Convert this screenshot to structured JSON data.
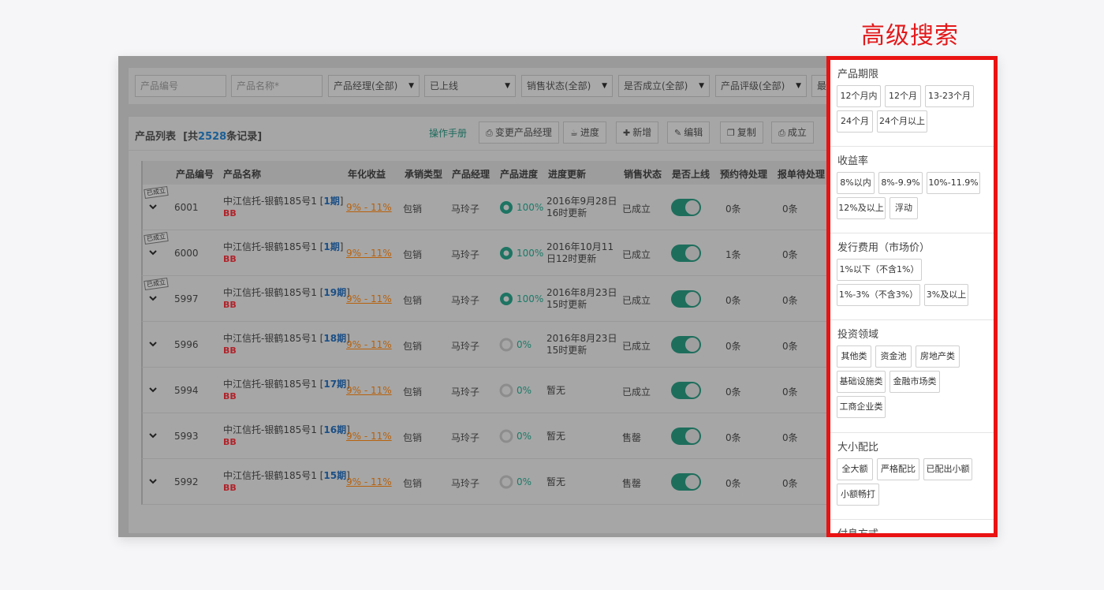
{
  "heading": "高级搜索",
  "filters": {
    "product_no_placeholder": "产品编号",
    "product_name_placeholder": "产品名称*",
    "manager": "产品经理(全部)",
    "online": "已上线",
    "sale_status": "销售状态(全部)",
    "established": "是否成立(全部)",
    "rating": "产品评级(全部)",
    "more": "最"
  },
  "list": {
    "title_prefix": "产品列表",
    "title_open": "[共",
    "count": "2528",
    "title_close": "条记录]",
    "manual_link": "操作手册",
    "toolbar": [
      {
        "icon": "print-icon",
        "label": "变更产品经理"
      },
      {
        "icon": "cup-icon",
        "label": "进度"
      },
      {
        "icon": "plus-icon",
        "label": "新增"
      },
      {
        "icon": "edit-icon",
        "label": "编辑"
      },
      {
        "icon": "copy-icon",
        "label": "复制"
      },
      {
        "icon": "print-icon",
        "label": "成立"
      }
    ],
    "columns": [
      "产品编号",
      "产品名称",
      "年化收益",
      "承销类型",
      "产品经理",
      "产品进度",
      "进度更新",
      "销售状态",
      "是否上线",
      "预约待处理",
      "报单待处理"
    ],
    "rows": [
      {
        "stamp": "已成立",
        "id": "6001",
        "name": "中江信托-银鹤185号1 [",
        "period": "1期",
        "close": "]",
        "tag": "BB",
        "yield": "9% - 11%",
        "type": "包销",
        "manager": "马玲子",
        "progress": "100%",
        "progress_value": 100,
        "update1": "2016年9月28日",
        "update2": "16时更新",
        "status": "已成立",
        "online": true,
        "reserve": "0条",
        "report": "0条"
      },
      {
        "stamp": "已成立",
        "id": "6000",
        "name": "中江信托-银鹤185号1 [",
        "period": "1期",
        "close": "]",
        "tag": "BB",
        "yield": "9% - 11%",
        "type": "包销",
        "manager": "马玲子",
        "progress": "100%",
        "progress_value": 100,
        "update1": "2016年10月11",
        "update2": "日12时更新",
        "status": "已成立",
        "online": true,
        "reserve": "1条",
        "report": "0条"
      },
      {
        "stamp": "已成立",
        "id": "5997",
        "name": "中江信托-银鹤185号1 [",
        "period": "19期",
        "close": "]",
        "tag": "BB",
        "yield": "9% - 11%",
        "type": "包销",
        "manager": "马玲子",
        "progress": "100%",
        "progress_value": 100,
        "update1": "2016年8月23日",
        "update2": "15时更新",
        "status": "已成立",
        "online": true,
        "reserve": "0条",
        "report": "0条"
      },
      {
        "stamp": "",
        "id": "5996",
        "name": "中江信托-银鹤185号1 [",
        "period": "18期",
        "close": "]",
        "tag": "BB",
        "yield": "9% - 11%",
        "type": "包销",
        "manager": "马玲子",
        "progress": "0%",
        "progress_value": 0,
        "update1": "2016年8月23日",
        "update2": "15时更新",
        "status": "已成立",
        "online": true,
        "reserve": "0条",
        "report": "0条"
      },
      {
        "stamp": "",
        "id": "5994",
        "name": "中江信托-银鹤185号1 [",
        "period": "17期",
        "close": "]",
        "tag": "BB",
        "yield": "9% - 11%",
        "type": "包销",
        "manager": "马玲子",
        "progress": "0%",
        "progress_value": 0,
        "update1": "暂无",
        "update2": "",
        "status": "已成立",
        "online": true,
        "reserve": "0条",
        "report": "0条"
      },
      {
        "stamp": "",
        "id": "5993",
        "name": "中江信托-银鹤185号1 [",
        "period": "16期",
        "close": "]",
        "tag": "BB",
        "yield": "9% - 11%",
        "type": "包销",
        "manager": "马玲子",
        "progress": "0%",
        "progress_value": 0,
        "update1": "暂无",
        "update2": "",
        "status": "售罄",
        "online": true,
        "reserve": "0条",
        "report": "0条"
      },
      {
        "stamp": "",
        "id": "5992",
        "name": "中江信托-银鹤185号1 [",
        "period": "15期",
        "close": "]",
        "tag": "BB",
        "yield": "9% - 11%",
        "type": "包销",
        "manager": "马玲子",
        "progress": "0%",
        "progress_value": 0,
        "update1": "暂无",
        "update2": "",
        "status": "售罄",
        "online": true,
        "reserve": "0条",
        "report": "0条"
      }
    ]
  },
  "advanced": {
    "groups": [
      {
        "title": "产品期限",
        "chips": [
          "12个月内",
          "12个月",
          "13-23个月",
          "24个月",
          "24个月以上"
        ]
      },
      {
        "title": "收益率",
        "chips": [
          "8%以内",
          "8%-9.9%",
          "10%-11.9%",
          "12%及以上",
          "浮动"
        ]
      },
      {
        "title": "发行费用（市场价）",
        "chips": [
          "1%以下（不含1%）",
          "1%-3%（不含3%）",
          "3%及以上"
        ]
      },
      {
        "title": "投资领域",
        "chips": [
          "其他类",
          "资金池",
          "房地产类",
          "基础设施类",
          "金融市场类",
          "工商企业类"
        ]
      },
      {
        "title": "大小配比",
        "chips": [
          "全大额",
          "严格配比",
          "已配出小额",
          "小额畅打"
        ]
      },
      {
        "title": "付息方式",
        "chips": []
      }
    ]
  },
  "colors": {
    "accent_red": "#ea1212",
    "toggle_on": "#1e6e5c",
    "yield_orange": "#b8620d",
    "link_teal": "#1d6b5c"
  }
}
